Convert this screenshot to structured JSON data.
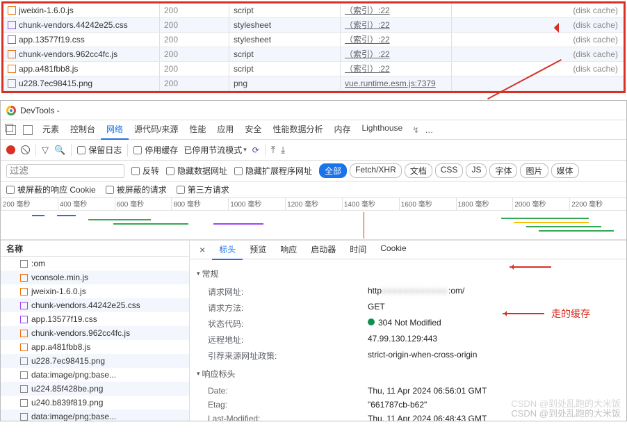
{
  "top_table": {
    "rows": [
      {
        "icon": "js",
        "name": "jweixin-1.6.0.js",
        "status": "200",
        "type": "script",
        "initiator": "（索引）:22",
        "size": "(disk cache)"
      },
      {
        "icon": "css",
        "name": "chunk-vendors.44242e25.css",
        "status": "200",
        "type": "stylesheet",
        "initiator": "（索引）:22",
        "size": "(disk cache)"
      },
      {
        "icon": "css",
        "name": "app.13577f19.css",
        "status": "200",
        "type": "stylesheet",
        "initiator": "（索引）:22",
        "size": "(disk cache)"
      },
      {
        "icon": "js",
        "name": "chunk-vendors.962cc4fc.js",
        "status": "200",
        "type": "script",
        "initiator": "（索引）:22",
        "size": "(disk cache)"
      },
      {
        "icon": "js",
        "name": "app.a481fbb8.js",
        "status": "200",
        "type": "script",
        "initiator": "（索引）:22",
        "size": "(disk cache)"
      },
      {
        "icon": "png",
        "name": "u228.7ec98415.png",
        "status": "200",
        "type": "png",
        "initiator": "vue.runtime.esm.js:7379",
        "size": ""
      }
    ]
  },
  "titlebar": {
    "text": "DevTools -"
  },
  "tabs": {
    "items": [
      "元素",
      "控制台",
      "网络",
      "源代码/来源",
      "性能",
      "应用",
      "安全",
      "性能数据分析",
      "内存",
      "Lighthouse"
    ],
    "active": "网络"
  },
  "toolbar": {
    "preserve_log": "保留日志",
    "disable_cache": "停用缓存",
    "throttle": "已停用节流模式"
  },
  "filterbar": {
    "filter_placeholder": "过滤",
    "invert": "反转",
    "hide_data_urls": "隐藏数据网址",
    "hide_ext_urls": "隐藏扩展程序网址",
    "pills": [
      "全部",
      "Fetch/XHR",
      "文档",
      "CSS",
      "JS",
      "字体",
      "图片",
      "媒体"
    ],
    "pill_active": "全部"
  },
  "cookiebar": {
    "blocked_cookies": "被屏蔽的响应 Cookie",
    "blocked_requests": "被屏蔽的请求",
    "third_party": "第三方请求"
  },
  "timeline_ticks": [
    "200 毫秒",
    "400 毫秒",
    "600 毫秒",
    "800 毫秒",
    "1000 毫秒",
    "1200 毫秒",
    "1400 毫秒",
    "1600 毫秒",
    "1800 毫秒",
    "2000 毫秒",
    "2200 毫秒"
  ],
  "left_panel": {
    "header": "名称",
    "rows": [
      {
        "icon": "doc",
        "name": ":om"
      },
      {
        "icon": "js",
        "name": "vconsole.min.js"
      },
      {
        "icon": "js",
        "name": "jweixin-1.6.0.js"
      },
      {
        "icon": "css",
        "name": "chunk-vendors.44242e25.css"
      },
      {
        "icon": "css",
        "name": "app.13577f19.css"
      },
      {
        "icon": "js",
        "name": "chunk-vendors.962cc4fc.js"
      },
      {
        "icon": "js",
        "name": "app.a481fbb8.js"
      },
      {
        "icon": "png",
        "name": "u228.7ec98415.png"
      },
      {
        "icon": "data",
        "name": "data:image/png;base..."
      },
      {
        "icon": "png",
        "name": "u224.85f428be.png"
      },
      {
        "icon": "png",
        "name": "u240.b839f819.png"
      },
      {
        "icon": "data",
        "name": "data:image/png;base..."
      }
    ]
  },
  "detail_tabs": {
    "items": [
      "标头",
      "预览",
      "响应",
      "启动器",
      "时间",
      "Cookie"
    ],
    "active": "标头"
  },
  "headers": {
    "general_title": "常规",
    "request_url_k": "请求网址:",
    "request_url_v_prefix": "http",
    "request_url_v_suffix": ":om/",
    "request_method_k": "请求方法:",
    "request_method_v": "GET",
    "status_code_k": "状态代码:",
    "status_code_v": "304 Not Modified",
    "remote_addr_k": "远程地址:",
    "remote_addr_v": "47.99.130.129:443",
    "referrer_policy_k": "引荐来源网址政策:",
    "referrer_policy_v": "strict-origin-when-cross-origin",
    "response_title": "响应标头",
    "date_k": "Date:",
    "date_v": "Thu, 11 Apr 2024 06:56:01 GMT",
    "etag_k": "Etag:",
    "etag_v": "\"661787cb-b62\"",
    "lastmod_k": "Last-Modified:",
    "lastmod_v": "Thu, 11 Apr 2024 06:48:43 GMT"
  },
  "annotation": "走的缓存",
  "watermark": "CSDN @到处乱跑的大米饭"
}
